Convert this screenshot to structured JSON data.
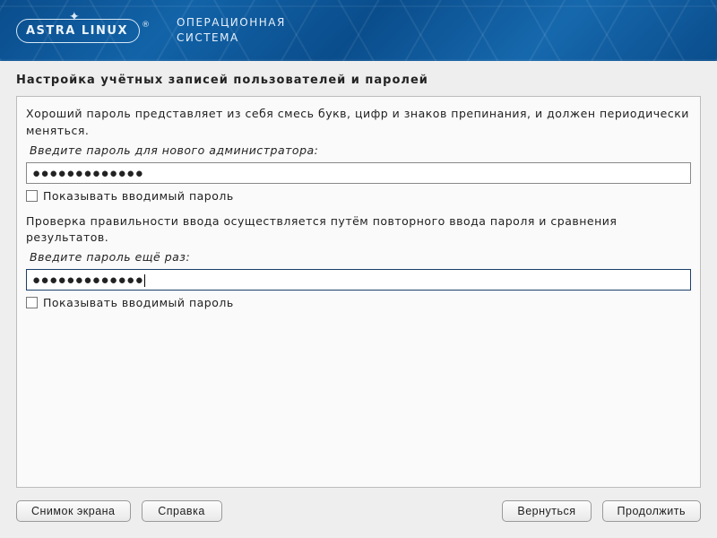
{
  "header": {
    "logo_text": "ASTRA LINUX",
    "tagline_line1": "ОПЕРАЦИОННАЯ",
    "tagline_line2": "СИСТЕМА"
  },
  "title": "Настройка учётных записей пользователей и паролей",
  "section1": {
    "description": "Хороший пароль представляет из себя смесь букв, цифр и знаков препинания, и должен периодически меняться.",
    "prompt": "Введите пароль для нового администратора:",
    "value_masked": "●●●●●●●●●●●●●",
    "show_password_label": "Показывать вводимый пароль",
    "show_password_checked": false
  },
  "section2": {
    "description": "Проверка правильности ввода осуществляется путём повторного ввода пароля и сравнения результатов.",
    "prompt": "Введите пароль ещё раз:",
    "value_masked": "●●●●●●●●●●●●●",
    "show_password_label": "Показывать вводимый пароль",
    "show_password_checked": false,
    "focused": true
  },
  "footer": {
    "screenshot": "Снимок экрана",
    "help": "Справка",
    "back": "Вернуться",
    "continue": "Продолжить"
  }
}
